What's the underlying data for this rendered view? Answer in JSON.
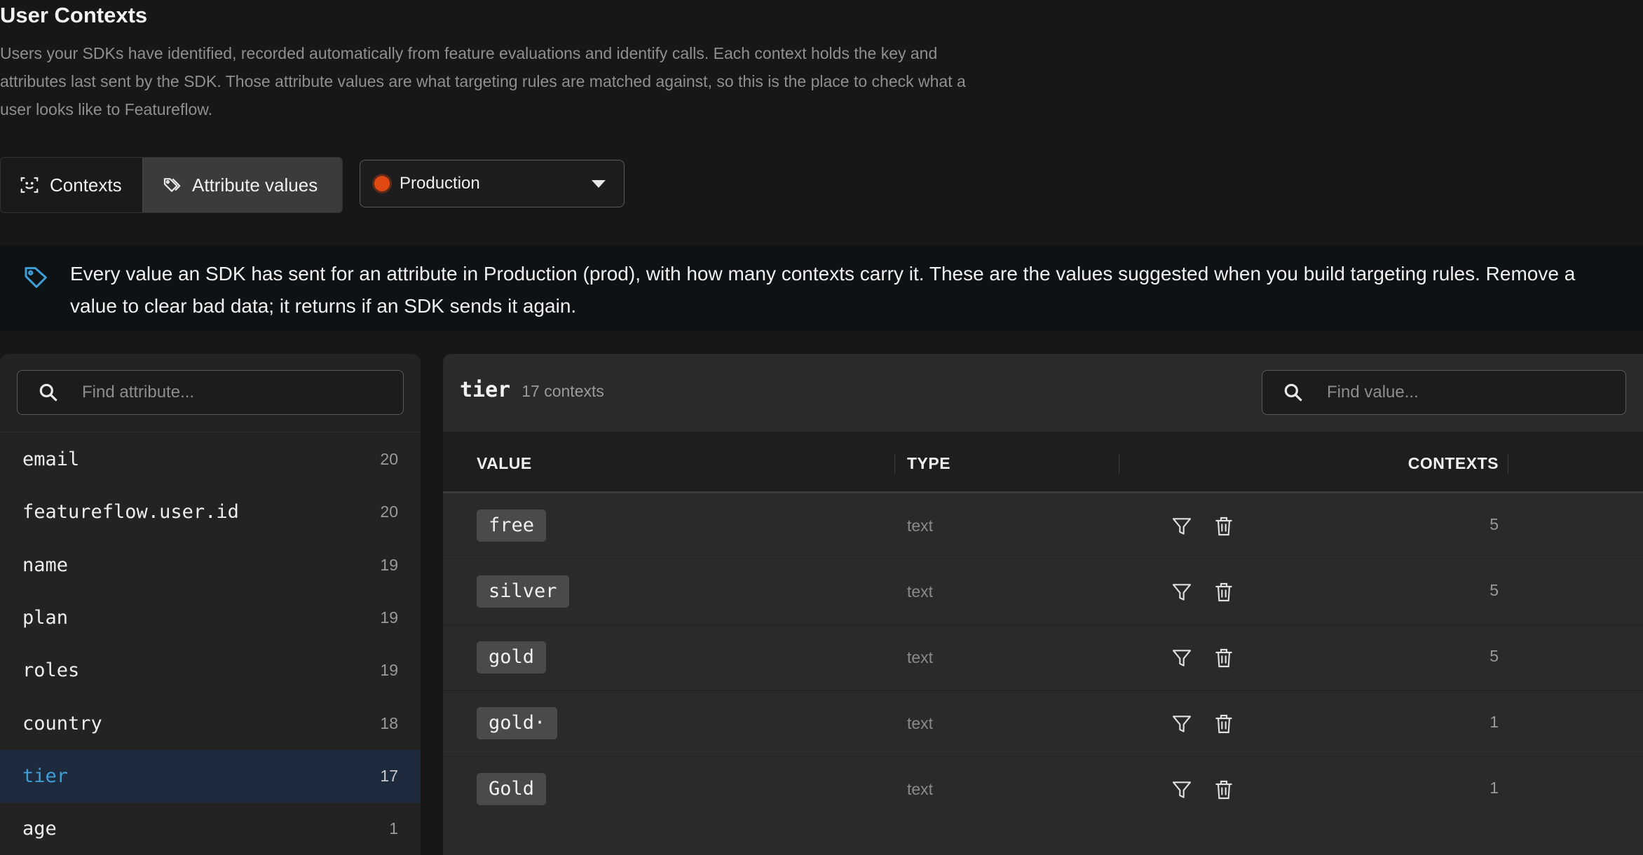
{
  "header": {
    "title": "User Contexts",
    "description": "Users your SDKs have identified, recorded automatically from feature evaluations and identify calls. Each context holds the key and attributes last sent by the SDK. Those attribute values are what targeting rules are matched against, so this is the place to check what a user looks like to Featureflow."
  },
  "tabs": {
    "contexts_label": "Contexts",
    "attribute_values_label": "Attribute values",
    "active": "Attribute values"
  },
  "environment": {
    "label": "Production",
    "dot_color": "#e04a12"
  },
  "banner": {
    "icon": "tag-icon",
    "text": "Every value an SDK has sent for an attribute in Production (prod), with how many contexts carry it. These are the values suggested when you build targeting rules. Remove a value to clear bad data; it returns if an SDK sends it again."
  },
  "attributes": {
    "search_placeholder": "Find attribute...",
    "items": [
      {
        "name": "email",
        "count": "20"
      },
      {
        "name": "featureflow.user.id",
        "count": "20"
      },
      {
        "name": "name",
        "count": "19"
      },
      {
        "name": "plan",
        "count": "19"
      },
      {
        "name": "roles",
        "count": "19"
      },
      {
        "name": "country",
        "count": "18"
      },
      {
        "name": "tier",
        "count": "17"
      },
      {
        "name": "age",
        "count": "1"
      }
    ],
    "selected": "tier"
  },
  "detail": {
    "attribute": "tier",
    "contexts_label": "17 contexts",
    "search_placeholder": "Find value...",
    "columns": {
      "value": "VALUE",
      "type": "TYPE",
      "contexts": "CONTEXTS"
    },
    "rows": [
      {
        "value": "free",
        "type": "text",
        "contexts": "5"
      },
      {
        "value": "silver",
        "type": "text",
        "contexts": "5"
      },
      {
        "value": "gold",
        "type": "text",
        "contexts": "5"
      },
      {
        "value": "gold·",
        "type": "text",
        "contexts": "1"
      },
      {
        "value": "Gold",
        "type": "text",
        "contexts": "1"
      }
    ]
  },
  "colors": {
    "background": "#171717",
    "accent": "#3d9fd6",
    "selected_row": "#1e2b3e"
  }
}
